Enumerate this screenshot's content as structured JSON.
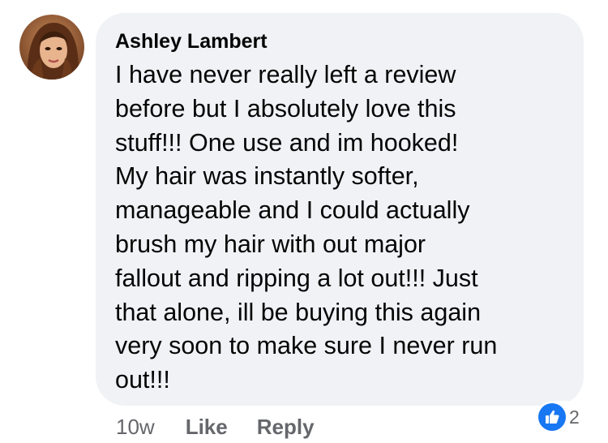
{
  "comment": {
    "author": "Ashley Lambert",
    "lines": [
      "I have never really left a review",
      "before but I absolutely love this",
      "stuff!!! One use and im hooked!",
      "My hair was instantly softer,",
      "manageable and I could actually",
      "brush my hair with out major",
      "fallout and ripping a lot out!!! Just",
      "that alone, ill be buying this again",
      "very soon to make sure I never run",
      "out!!!"
    ],
    "time": "10w",
    "like_label": "Like",
    "reply_label": "Reply",
    "reaction_icon": "thumbs-up-icon",
    "reaction_count": "2"
  },
  "colors": {
    "bubble": "#f0f2f5",
    "text": "#050505",
    "meta": "#65676b",
    "like_blue": "#1877f2"
  }
}
